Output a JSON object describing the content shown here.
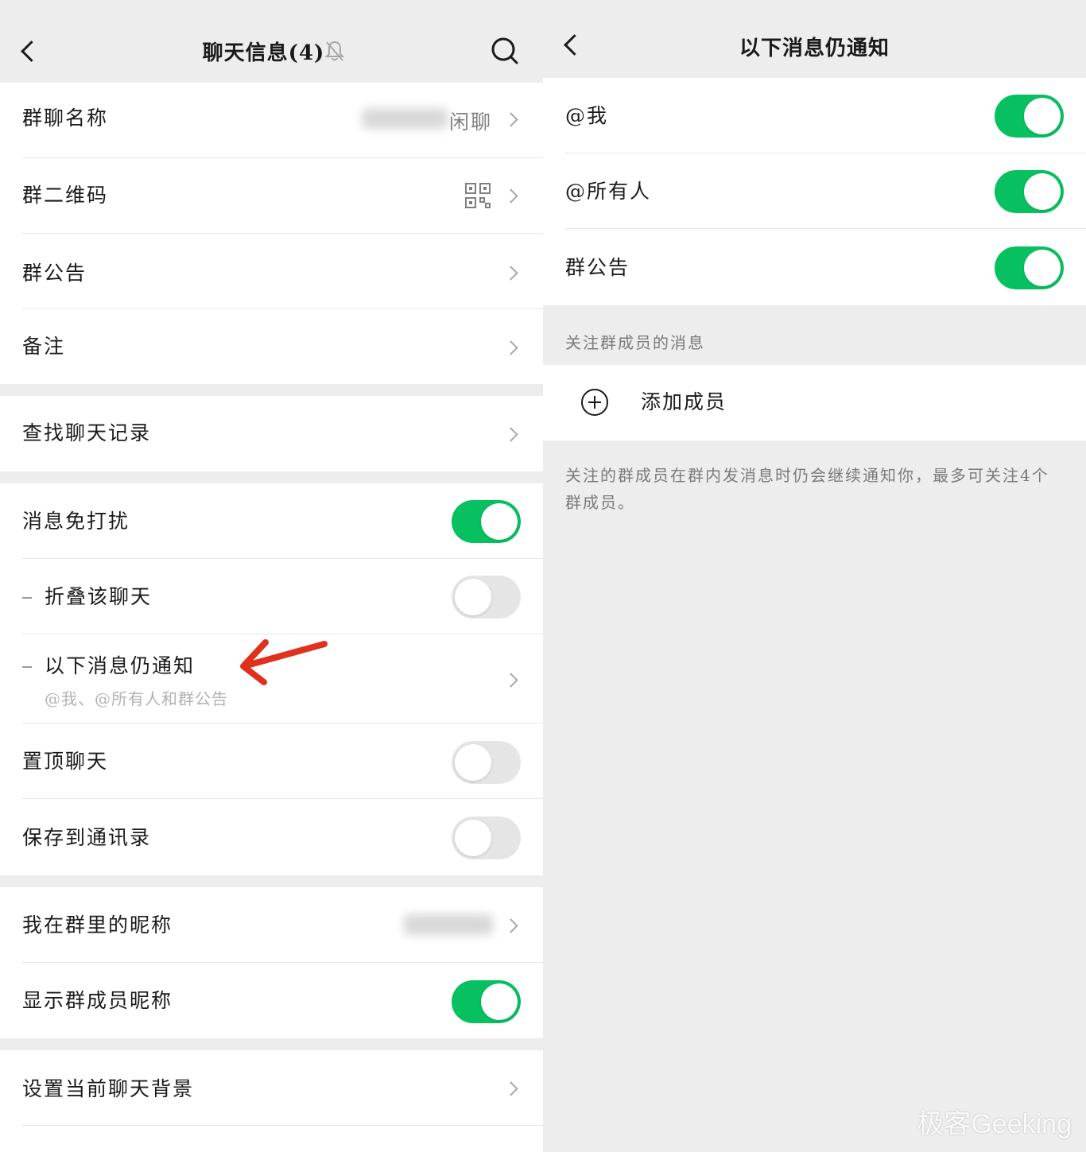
{
  "left": {
    "title": "聊天信息(4)",
    "group1": [
      {
        "label": "群聊名称",
        "value": "闲聊"
      },
      {
        "label": "群二维码"
      },
      {
        "label": "群公告"
      },
      {
        "label": "备注"
      }
    ],
    "group2": [
      {
        "label": "查找聊天记录"
      }
    ],
    "group3": {
      "mute": {
        "label": "消息免打扰",
        "on": true
      },
      "fold": {
        "label": "折叠该聊天",
        "on": false
      },
      "notify": {
        "label": "以下消息仍通知",
        "sub": "@我、@所有人和群公告"
      },
      "pin": {
        "label": "置顶聊天",
        "on": false
      },
      "save": {
        "label": "保存到通讯录",
        "on": false
      }
    },
    "group4": {
      "nickname": {
        "label": "我在群里的昵称"
      },
      "show_nick": {
        "label": "显示群成员昵称",
        "on": true
      }
    },
    "group5": {
      "background": {
        "label": "设置当前聊天背景"
      }
    }
  },
  "right": {
    "title": "以下消息仍通知",
    "items": [
      {
        "label": "@我",
        "on": true
      },
      {
        "label": "@所有人",
        "on": true
      },
      {
        "label": "群公告",
        "on": true
      }
    ],
    "section_header": "关注群成员的消息",
    "add_member": "添加成员",
    "footnote": "关注的群成员在群内发消息时仍会继续通知你，最多可关注4个群成员。"
  },
  "watermark": "极客Geeking",
  "colors": {
    "accent": "#07c160",
    "background": "#ededed"
  }
}
